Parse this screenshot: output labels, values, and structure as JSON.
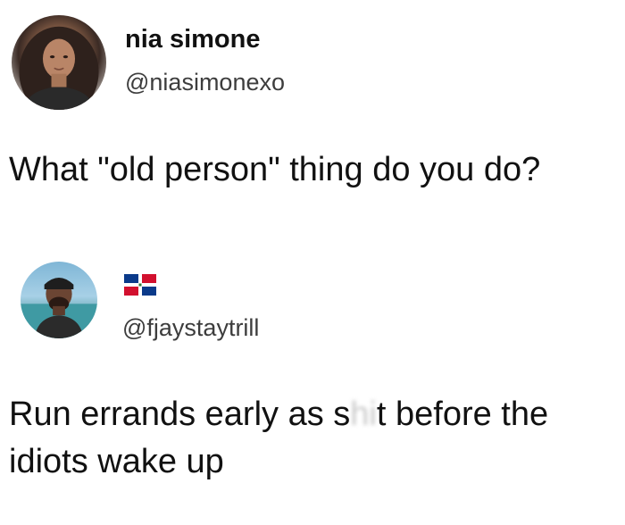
{
  "post1": {
    "display_name": "nia simone",
    "handle": "@niasimonexo",
    "text": "What \"old person\" thing do you do?",
    "avatar_icon": "profile-photo-woman"
  },
  "post2": {
    "flag_icon": "dominican-republic-flag",
    "handle": "@fjaystaytrill",
    "text_before": "Run errands early as s",
    "text_censored": "hi",
    "text_after": "t before the idiots wake up",
    "avatar_icon": "profile-photo-man"
  }
}
